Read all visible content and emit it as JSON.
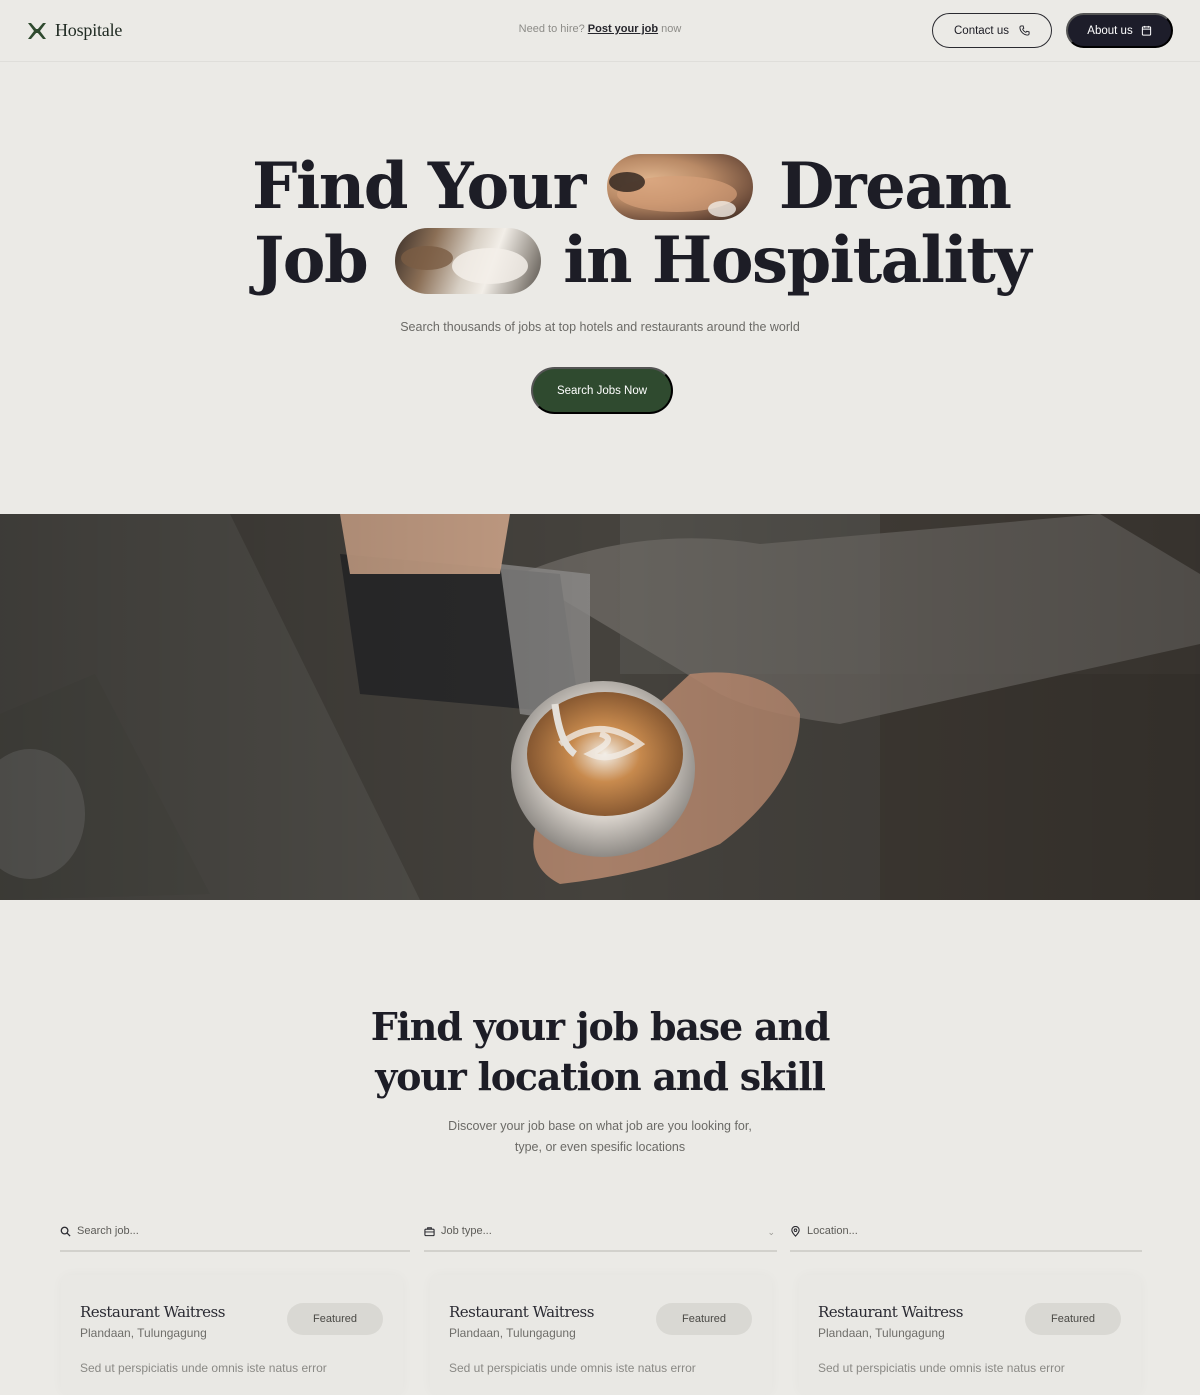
{
  "brand": {
    "name": "Hospitale"
  },
  "nav": {
    "prompt_text": "Need to hire?",
    "post_link": "Post your job",
    "suffix": "now",
    "contact_label": "Contact us",
    "about_label": "About us"
  },
  "hero": {
    "title_line1_a": "Find Your",
    "title_line1_b": "Dream",
    "title_line2_a": "Job",
    "title_line2_b": "in Hospitality",
    "subtitle": "Search thousands of jobs at top hotels and restaurants around the world",
    "cta_label": "Search Jobs Now"
  },
  "section": {
    "title_line1": "Find your job base and",
    "title_line2": "your location and skill",
    "sub_line1": "Discover your job base on what job are you looking for,",
    "sub_line2": "type, or even spesific locations"
  },
  "filters": {
    "search_placeholder": "Search job...",
    "type_placeholder": "Job type...",
    "location_placeholder": "Location..."
  },
  "jobs": [
    {
      "title": "Restaurant Waitress",
      "location": "Plandaan, Tulungagung",
      "badge": "Featured",
      "description": "Sed ut perspiciatis unde omnis iste natus error"
    },
    {
      "title": "Restaurant Waitress",
      "location": "Plandaan, Tulungagung",
      "badge": "Featured",
      "description": "Sed ut perspiciatis unde omnis iste natus error"
    },
    {
      "title": "Restaurant Waitress",
      "location": "Plandaan, Tulungagung",
      "badge": "Featured",
      "description": "Sed ut perspiciatis unde omnis iste natus error"
    }
  ],
  "icons": {
    "logo": "brand-logo-icon",
    "phone": "phone-icon",
    "about": "calendar-icon",
    "search": "search-icon",
    "briefcase": "briefcase-icon",
    "location": "location-pin-icon",
    "dropdown": "chevron-down-icon"
  },
  "colors": {
    "background": "#ebeae6",
    "accent_green": "#2f4a2f",
    "dark_button": "#1d1d2a",
    "text": "#1d1d26"
  }
}
